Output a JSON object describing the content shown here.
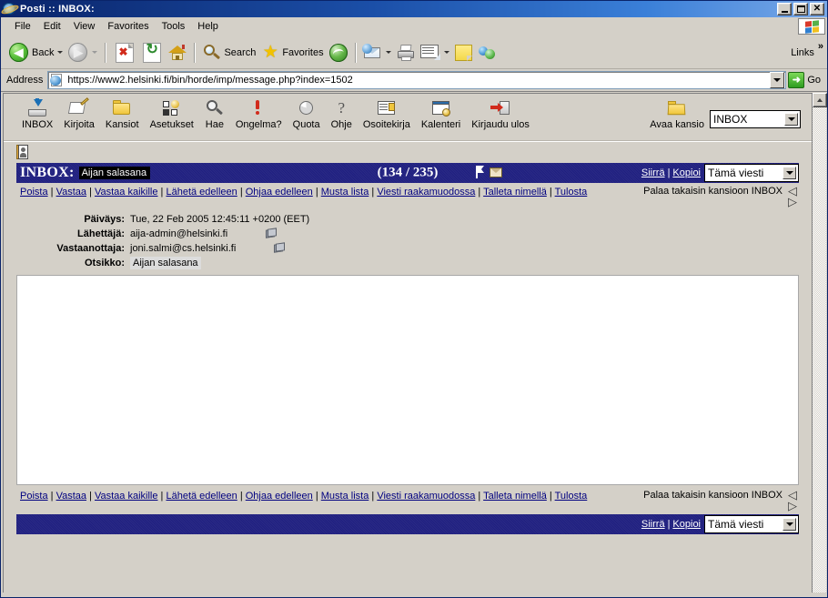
{
  "window": {
    "title": "Posti :: INBOX:",
    "minimize": "_",
    "maximize": "□",
    "close": "✕"
  },
  "menubar": {
    "items": [
      "File",
      "Edit",
      "View",
      "Favorites",
      "Tools",
      "Help"
    ]
  },
  "toolbar": {
    "back": "Back",
    "forward": "",
    "search": "Search",
    "favorites": "Favorites",
    "links": "Links",
    "chevrons": "»"
  },
  "addressbar": {
    "label": "Address",
    "url": "https://www2.helsinki.fi/bin/horde/imp/message.php?index=1502",
    "go": "Go"
  },
  "imp_menu": {
    "items": [
      {
        "label": "INBOX",
        "icon": "inbox-icon"
      },
      {
        "label": "Kirjoita",
        "icon": "compose-pen-icon"
      },
      {
        "label": "Kansiot",
        "icon": "folder-icon"
      },
      {
        "label": "Asetukset",
        "icon": "preferences-icon"
      },
      {
        "label": "Hae",
        "icon": "search-magnifier-icon"
      },
      {
        "label": "Ongelma?",
        "icon": "problem-exclamation-icon"
      },
      {
        "label": "Quota",
        "icon": "quota-pie-icon"
      },
      {
        "label": "Ohje",
        "icon": "help-question-icon"
      },
      {
        "label": "Osoitekirja",
        "icon": "addressbook-icon"
      },
      {
        "label": "Kalenteri",
        "icon": "calendar-icon"
      },
      {
        "label": "Kirjaudu ulos",
        "icon": "logout-icon"
      }
    ],
    "open_folder_label": "Avaa kansio",
    "folder_selected": "INBOX"
  },
  "message": {
    "mailbox_label": "INBOX:",
    "subject_chip": "Aijan salasana",
    "counter": "(134 / 235)",
    "move_label": "Siirrä",
    "copy_label": "Kopioi",
    "separator": "|",
    "scope_selected": "Tämä viesti",
    "nav_links": [
      "Poista",
      "Vastaa",
      "Vastaa kaikille",
      "Lähetä edelleen",
      "Ohjaa edelleen",
      "Musta lista",
      "Viesti raakamuodossa",
      "Talleta nimellä",
      "Tulosta"
    ],
    "back_to_folder": "Palaa takaisin kansioon INBOX",
    "prev_arrow": "◁",
    "next_arrow": "▷",
    "headers": [
      {
        "label": "Päiväys:",
        "value": "Tue, 22 Feb 2005 12:45:11 +0200 (EET)",
        "has_book": false,
        "boxed": false
      },
      {
        "label": "Lähettäjä:",
        "value": "aija-admin@helsinki.fi",
        "has_book": true,
        "boxed": false
      },
      {
        "label": "Vastaanottaja:",
        "value": "joni.salmi@cs.helsinki.fi",
        "has_book": true,
        "boxed": false
      },
      {
        "label": "Otsikko:",
        "value": "Aijan salasana",
        "has_book": false,
        "boxed": true
      }
    ],
    "body_text": ""
  },
  "colors": {
    "title_bar_blue": "#0a246a",
    "imp_bar_blue": "#202080",
    "chrome_gray": "#d4d0c8",
    "link_blue": "#000080",
    "go_green": "#2e9c1f"
  }
}
